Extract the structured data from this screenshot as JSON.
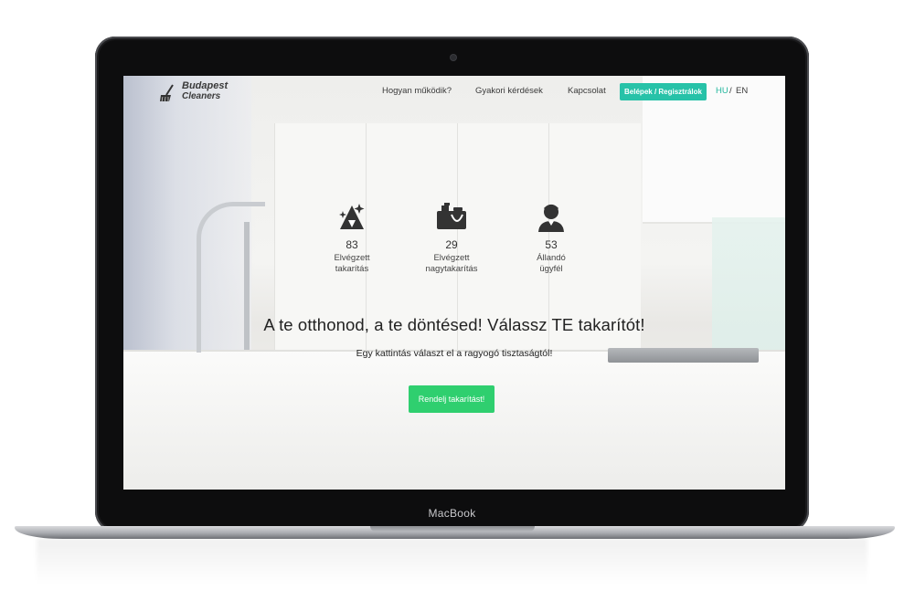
{
  "device": {
    "brand": "MacBook"
  },
  "site": {
    "logo": {
      "line1": "Budapest",
      "line2": "Cleaners",
      "icon": "broom-icon"
    },
    "nav": {
      "links": [
        "Hogyan működik?",
        "Gyakori kérdések",
        "Kapcsolat"
      ],
      "login_button": "Belépek / Regisztrálok",
      "lang_active": "HU",
      "lang_separator": "/",
      "lang_other": "EN"
    },
    "stats": [
      {
        "icon": "sparkle-cleaning-icon",
        "value": "83",
        "label": "Elvégzett\ntakarítás"
      },
      {
        "icon": "cleaning-supplies-icon",
        "value": "29",
        "label": "Elvégzett\nnagytakarítás"
      },
      {
        "icon": "customer-icon",
        "value": "53",
        "label": "Állandó\nügyfél"
      }
    ],
    "headline": "A te otthonod, a te döntésed! Válassz TE takarítót!",
    "subline": "Egy kattintás választ el a ragyogó tisztaságtól!",
    "cta_button": "Rendelj takarítást!",
    "colors": {
      "accent_teal": "#27c2a8",
      "cta_green": "#2fcf6f",
      "lang_active": "#27b89f"
    }
  }
}
